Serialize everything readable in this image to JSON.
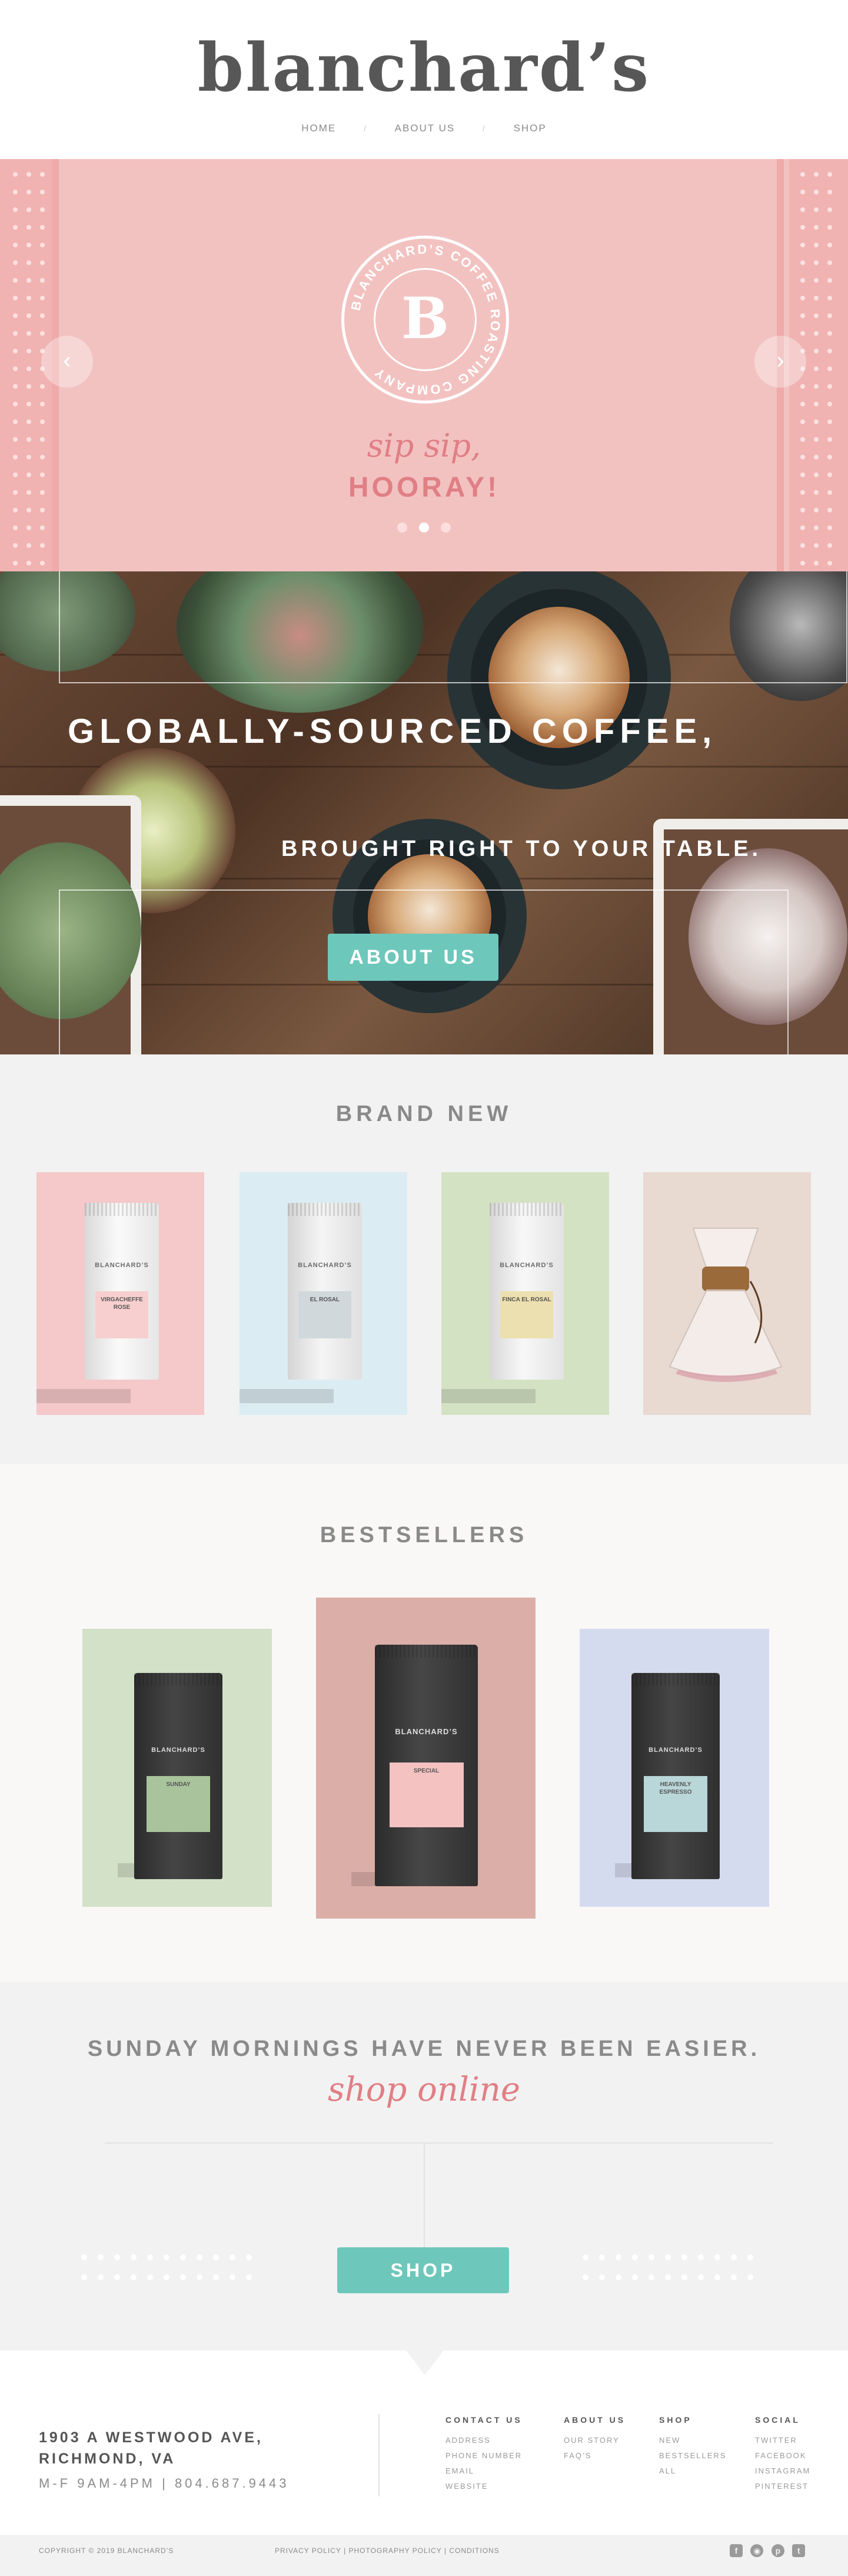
{
  "header": {
    "logo": "blanchard’s",
    "nav": [
      {
        "label": "HOME"
      },
      {
        "label": "ABOUT US"
      },
      {
        "label": "SHOP"
      }
    ]
  },
  "hero": {
    "badge_monogram": "B",
    "badge_text": "BLANCHARD’S COFFEE ROASTING COMPANY",
    "script_line": "sip sip,",
    "headline": "HOORAY!",
    "slide_count": 3,
    "active_slide": 2,
    "prev_icon": "chevron-left-icon",
    "next_icon": "chevron-right-icon"
  },
  "banner": {
    "line1": "GLOBALLY-SOURCED COFFEE,",
    "line2": "BROUGHT RIGHT TO YOUR TABLE.",
    "button": "ABOUT US"
  },
  "brand_new": {
    "title": "BRAND NEW",
    "products": [
      {
        "bg": "#f5c8c9",
        "bag_brand": "BLANCHARD’S",
        "label_name": "VIRGACHEFFE ROSE",
        "label_color": "#f7cfce",
        "kind": "bag"
      },
      {
        "bg": "#dcecf3",
        "bag_brand": "BLANCHARD’S",
        "label_name": "EL ROSAL",
        "label_color": "#d0d8dc",
        "kind": "bag"
      },
      {
        "bg": "#d4e2c4",
        "bag_brand": "BLANCHARD’S",
        "label_name": "FINCA EL ROSAL",
        "label_color": "#ecdfb0",
        "kind": "bag"
      },
      {
        "bg": "#e8d9d1",
        "kind": "chemex"
      }
    ]
  },
  "bestsellers": {
    "title": "BESTSELLERS",
    "products": [
      {
        "bg": "#d3e1c8",
        "bag_brand": "BLANCHARD’S",
        "label_name": "SUNDAY",
        "label_color": "#a9c49c"
      },
      {
        "bg": "#dcaea8",
        "bag_brand": "BLANCHARD’S",
        "label_name": "SPECIAL",
        "label_color": "#f3c2c1"
      },
      {
        "bg": "#d5dbef",
        "bag_brand": "BLANCHARD’S",
        "label_name": "HEAVENLY ESPRESSO",
        "label_color": "#b9d6d8"
      }
    ]
  },
  "sunday": {
    "tagline": "SUNDAY MORNINGS HAVE NEVER BEEN EASIER.",
    "script": "shop online",
    "button": "SHOP"
  },
  "footer": {
    "address_line1": "1903 A WESTWOOD AVE,",
    "address_line2": "RICHMOND, VA",
    "hours": "M-F 9AM-4PM  |  804.687.9443",
    "columns": [
      {
        "heading": "CONTACT US",
        "links": [
          "ADDRESS",
          "PHONE NUMBER",
          "EMAIL",
          "WEBSITE"
        ]
      },
      {
        "heading": "ABOUT US",
        "links": [
          "OUR STORY",
          "FAQ’S"
        ]
      },
      {
        "heading": "SHOP",
        "links": [
          "NEW",
          "BESTSELLERS",
          "ALL"
        ]
      },
      {
        "heading": "SOCIAL",
        "links": [
          "TWITTER",
          "FACEBOOK",
          "INSTAGRAM",
          "PINTEREST"
        ]
      }
    ],
    "copyright": "COPYRIGHT © 2019 BLANCHARD’S",
    "legal": [
      "PRIVACY POLICY",
      "PHOTOGRAPHY POLICY",
      "CONDITIONS"
    ],
    "social_icons": [
      "facebook-icon",
      "instagram-icon",
      "pinterest-icon",
      "twitter-icon"
    ]
  },
  "colors": {
    "accent_teal": "#6ec7bb",
    "accent_pink": "#e07f85",
    "hero_pink": "#f2c2c1",
    "logo_gray": "#575757"
  }
}
